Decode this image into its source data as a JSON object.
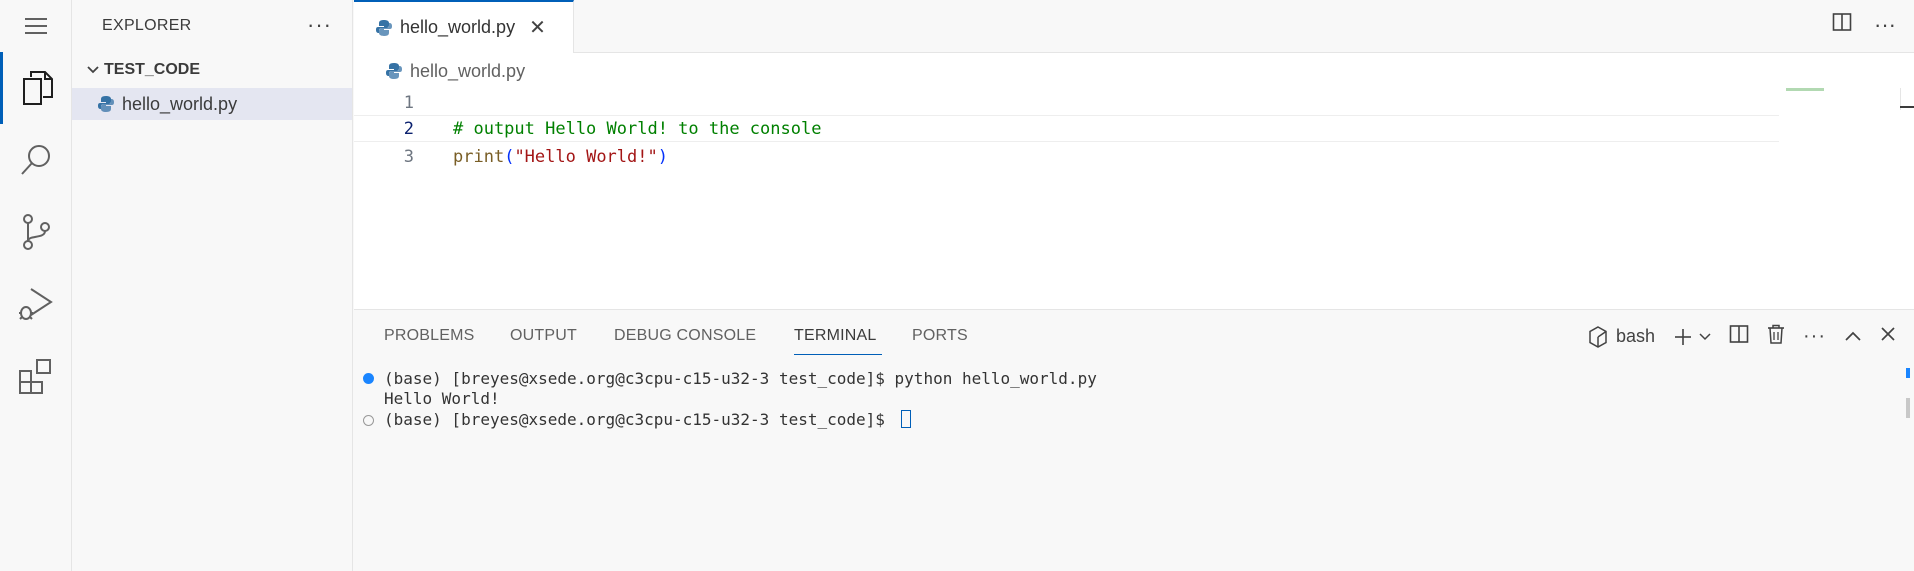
{
  "sidebar": {
    "title": "EXPLORER",
    "folder": "TEST_CODE",
    "files": [
      {
        "name": "hello_world.py"
      }
    ]
  },
  "editor": {
    "tab_label": "hello_world.py",
    "breadcrumb": "hello_world.py",
    "lines": [
      {
        "number": "1",
        "text": ""
      },
      {
        "number": "2",
        "text": "# output Hello World! to the console"
      },
      {
        "number": "3",
        "func": "print",
        "open": "(",
        "string": "\"Hello World!\"",
        "close": ")"
      }
    ]
  },
  "panel": {
    "tabs": [
      {
        "label": "PROBLEMS"
      },
      {
        "label": "OUTPUT"
      },
      {
        "label": "DEBUG CONSOLE"
      },
      {
        "label": "TERMINAL"
      },
      {
        "label": "PORTS"
      }
    ],
    "active_tab": "TERMINAL",
    "shell": "bash",
    "terminal_lines": [
      "(base) [breyes@xsede.org@c3cpu-c15-u32-3 test_code]$ python hello_world.py",
      "Hello World!",
      "(base) [breyes@xsede.org@c3cpu-c15-u32-3 test_code]$ "
    ]
  },
  "colors": {
    "accent": "#005fb8",
    "comment": "#008000",
    "string": "#a31515",
    "function": "#795e26"
  }
}
